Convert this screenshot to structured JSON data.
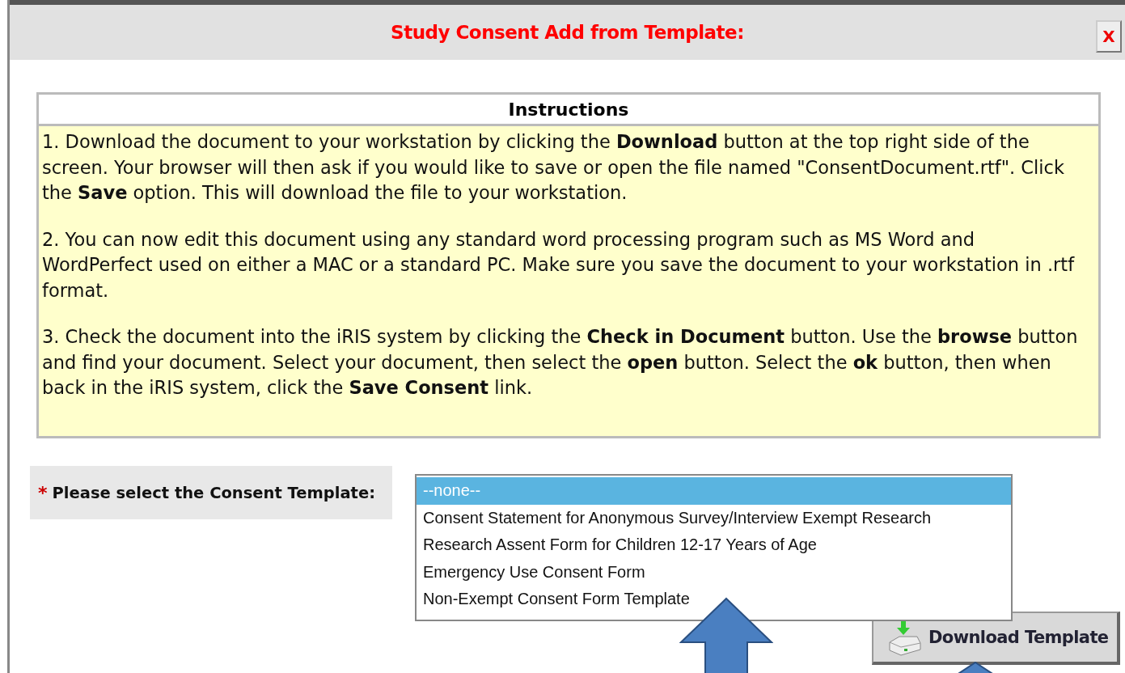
{
  "dialog": {
    "title": "Study Consent Add from Template:",
    "close_label": "X"
  },
  "instructions": {
    "heading": "Instructions",
    "paragraphs": [
      "1. Download the document to your workstation by clicking the **Download** button at the top right side of the screen. Your browser will then ask if you would like to save or open the file named \"ConsentDocument.rtf\". Click the **Save** option. This will download the file to your workstation.",
      "2. You can now edit this document using any standard word processing program such as MS Word and WordPerfect used on either a MAC or a standard PC. Make sure you save the document to your workstation in .rtf format.",
      "3. Check the document into the iRIS system by clicking the **Check in Document** button. Use the **browse** button and find your document. Select your document, then select the **open** button. Select the **ok** button, then when back in the iRIS system, click the **Save Consent** link."
    ]
  },
  "template_field": {
    "required": true,
    "required_mark": "*",
    "label": "Please select the Consent Template:",
    "options": [
      {
        "label": "--none--",
        "selected": true
      },
      {
        "label": "Consent Statement for Anonymous Survey/Interview Exempt Research",
        "selected": false
      },
      {
        "label": "Research Assent Form for Children 12-17 Years of Age",
        "selected": false
      },
      {
        "label": "Emergency Use Consent Form",
        "selected": false
      },
      {
        "label": "Non-Exempt Consent Form Template",
        "selected": false
      }
    ]
  },
  "download_button": {
    "label": "Download Template"
  }
}
